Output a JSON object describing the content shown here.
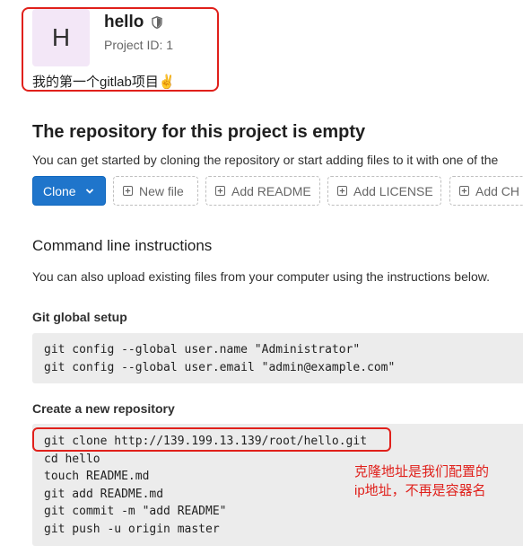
{
  "project": {
    "avatar_letter": "H",
    "name": "hello",
    "id_text": "Project ID: 1",
    "description": "我的第一个gitlab项目✌️"
  },
  "empty_repo": {
    "title": "The repository for this project is empty",
    "description": "You can get started by cloning the repository or start adding files to it with one of the"
  },
  "buttons": {
    "clone": "Clone",
    "new_file": "New file",
    "add_readme": "Add README",
    "add_license": "Add LICENSE",
    "add_changelog": "Add CH"
  },
  "cli": {
    "title": "Command line instructions",
    "description": "You can also upload existing files from your computer using the instructions below."
  },
  "global_setup": {
    "title": "Git global setup",
    "lines": [
      "git config --global user.name \"Administrator\"",
      "git config --global user.email \"admin@example.com\""
    ]
  },
  "new_repo": {
    "title": "Create a new repository",
    "lines": [
      "git clone http://139.199.13.139/root/hello.git",
      "cd hello",
      "touch README.md",
      "git add README.md",
      "git commit -m \"add README\"",
      "git push -u origin master"
    ]
  },
  "annotation": {
    "line1": "克隆地址是我们配置的",
    "line2": "ip地址，不再是容器名",
    "color": "#e0201b"
  },
  "colors": {
    "primary": "#1f75cb",
    "avatar_bg": "#f3e7f7",
    "code_bg": "#ececec"
  }
}
